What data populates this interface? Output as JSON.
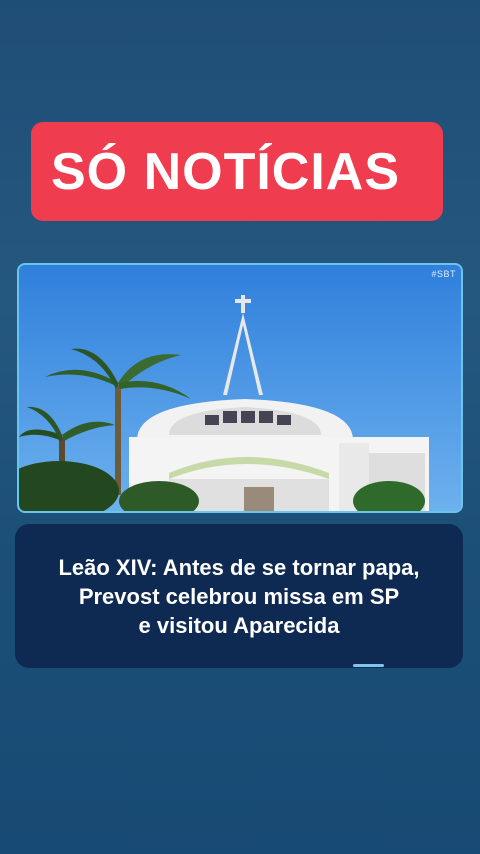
{
  "banner": {
    "title": "SÓ NOTÍCIAS",
    "color": "#ef3c4e"
  },
  "photo": {
    "watermark": "#SBT",
    "alt_subject": "church"
  },
  "headline": {
    "line1": "Leão XIV: Antes de se tornar papa,",
    "line2": "Prevost celebrou missa em SP",
    "line3": "e visitou Aparecida"
  },
  "colors": {
    "background_top": "#1f4d76",
    "headline_card": "#0f2a52",
    "accent": "#7fc4ee"
  }
}
